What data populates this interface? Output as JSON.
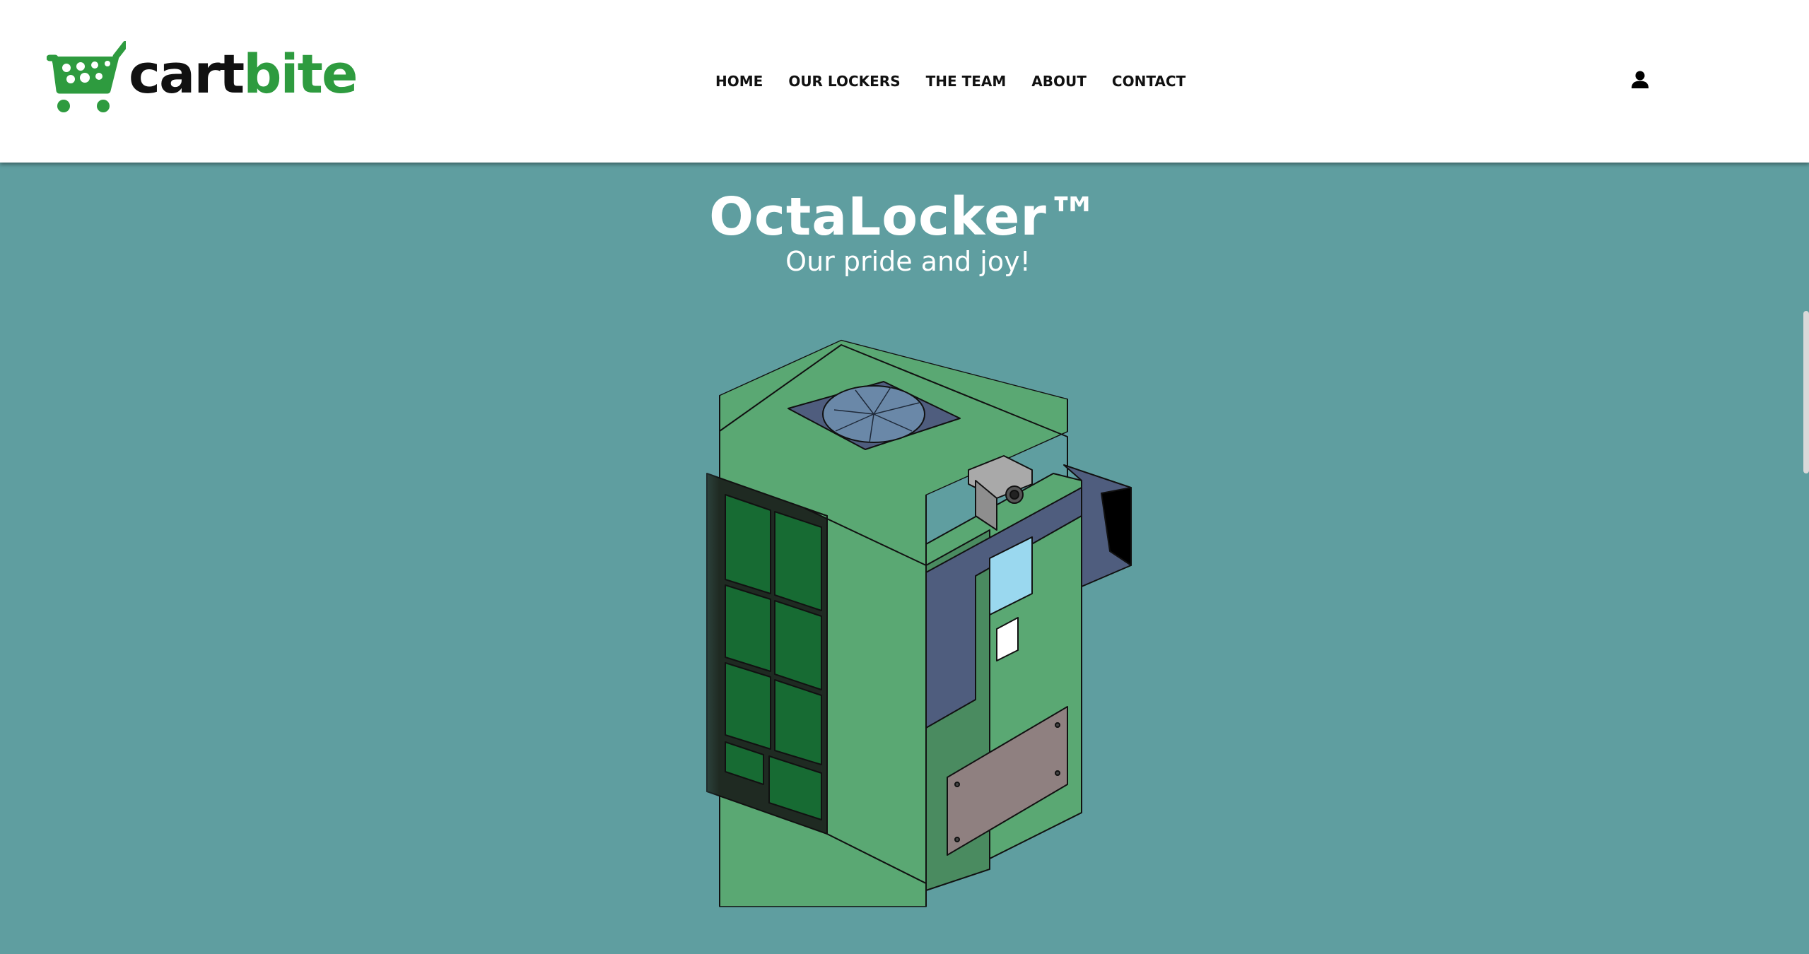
{
  "brand": {
    "name_part1": "cart",
    "name_part2": "bite",
    "colors": {
      "green": "#2e9b3f",
      "dark": "#111111"
    }
  },
  "nav": {
    "items": [
      {
        "label": "HOME"
      },
      {
        "label": "OUR LOCKERS"
      },
      {
        "label": "THE TEAM"
      },
      {
        "label": "ABOUT"
      },
      {
        "label": "CONTACT"
      }
    ]
  },
  "header": {
    "account_icon": "user-icon"
  },
  "hero": {
    "title": "OctaLocker™",
    "subtitle": "Our pride and joy!",
    "background_color": "#5f9ea0",
    "image": "octalocker-illustration"
  }
}
